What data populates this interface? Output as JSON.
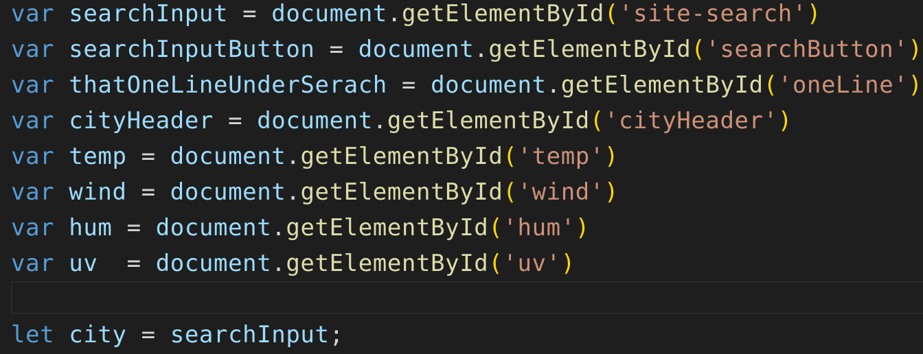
{
  "colors": {
    "background": "#1e1e1e",
    "keyword": "#569cd6",
    "variable": "#9cdcfe",
    "function": "#dcdcaa",
    "string": "#ce9178",
    "bracket": "#ffd700",
    "plain": "#d4d4d4"
  },
  "lines": [
    {
      "keyword": "var",
      "name": "searchInput",
      "assign": " = ",
      "obj": "document",
      "dot": ".",
      "method": "getElementById",
      "open": "(",
      "arg": "'site-search'",
      "close": ")"
    },
    {
      "keyword": "var",
      "name": "searchInputButton",
      "assign": " = ",
      "obj": "document",
      "dot": ".",
      "method": "getElementById",
      "open": "(",
      "arg": "'searchButton'",
      "close": ")"
    },
    {
      "keyword": "var",
      "name": "thatOneLineUnderSerach",
      "assign": " = ",
      "obj": "document",
      "dot": ".",
      "method": "getElementById",
      "open": "(",
      "arg": "'oneLine'",
      "close": ")"
    },
    {
      "keyword": "var",
      "name": "cityHeader",
      "assign": " = ",
      "obj": "document",
      "dot": ".",
      "method": "getElementById",
      "open": "(",
      "arg": "'cityHeader'",
      "close": ")"
    },
    {
      "keyword": "var",
      "name": "temp",
      "assign": " = ",
      "obj": "document",
      "dot": ".",
      "method": "getElementById",
      "open": "(",
      "arg": "'temp'",
      "close": ")"
    },
    {
      "keyword": "var",
      "name": "wind",
      "assign": " = ",
      "obj": "document",
      "dot": ".",
      "method": "getElementById",
      "open": "(",
      "arg": "'wind'",
      "close": ")"
    },
    {
      "keyword": "var",
      "name": "hum",
      "assign": " = ",
      "obj": "document",
      "dot": ".",
      "method": "getElementById",
      "open": "(",
      "arg": "'hum'",
      "close": ")"
    },
    {
      "keyword": "var",
      "name": "uv",
      "assign": "  = ",
      "obj": "document",
      "dot": ".",
      "method": "getElementById",
      "open": "(",
      "arg": "'uv'",
      "close": ")"
    }
  ],
  "last_line": {
    "keyword": "let",
    "name": "city",
    "assign": " = ",
    "value": "searchInput",
    "semicolon": ";"
  }
}
